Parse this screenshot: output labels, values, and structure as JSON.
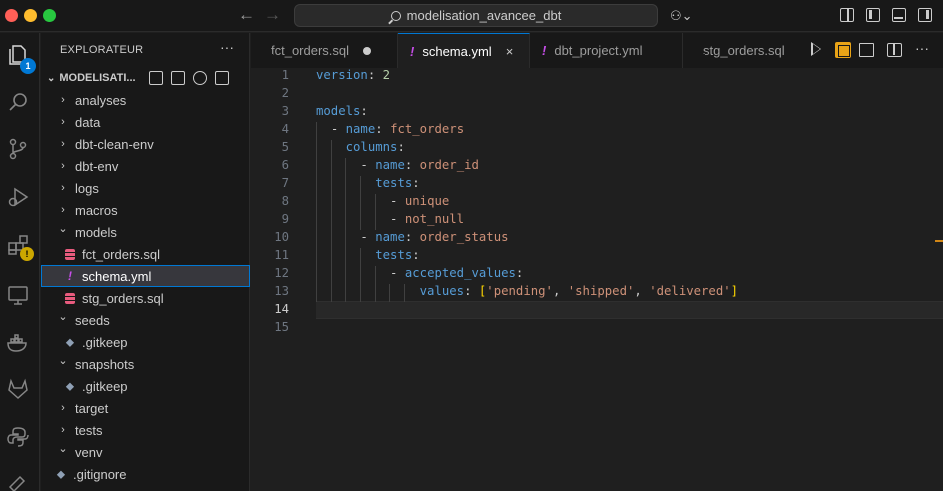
{
  "titlebar": {
    "search_text": "modelisation_avancee_dbt",
    "back_arrow": "←",
    "forward_arrow": "→",
    "copilot_glyph": "⚇⌄"
  },
  "activity": {
    "explorer_badge": "1",
    "extensions_warning": "!"
  },
  "sidebar": {
    "title": "EXPLORATEUR",
    "more": "···",
    "root_label": "MODELISATI...",
    "items": [
      {
        "label": "analyses",
        "kind": "folder",
        "open": false
      },
      {
        "label": "data",
        "kind": "folder",
        "open": false
      },
      {
        "label": "dbt-clean-env",
        "kind": "folder",
        "open": false
      },
      {
        "label": "dbt-env",
        "kind": "folder",
        "open": false
      },
      {
        "label": "logs",
        "kind": "folder",
        "open": false
      },
      {
        "label": "macros",
        "kind": "folder",
        "open": false
      },
      {
        "label": "models",
        "kind": "folder",
        "open": true
      },
      {
        "label": "fct_orders.sql",
        "kind": "sql"
      },
      {
        "label": "schema.yml",
        "kind": "yml",
        "selected": true
      },
      {
        "label": "stg_orders.sql",
        "kind": "sql"
      },
      {
        "label": "seeds",
        "kind": "folder",
        "open": true
      },
      {
        "label": ".gitkeep",
        "kind": "gitkeep"
      },
      {
        "label": "snapshots",
        "kind": "folder",
        "open": true
      },
      {
        "label": ".gitkeep",
        "kind": "gitkeep"
      },
      {
        "label": "target",
        "kind": "folder",
        "open": false
      },
      {
        "label": "tests",
        "kind": "folder",
        "open": false
      },
      {
        "label": "venv",
        "kind": "folder",
        "open": true
      },
      {
        "label": ".gitignore",
        "kind": "gitignore"
      }
    ]
  },
  "tabs": [
    {
      "label": "fct_orders.sql",
      "kind": "sql",
      "modified": true
    },
    {
      "label": "schema.yml",
      "kind": "yml",
      "active": true,
      "close": "×"
    },
    {
      "label": "dbt_project.yml",
      "kind": "yml"
    },
    {
      "label": "stg_orders.sql",
      "kind": "sql"
    }
  ],
  "editor": {
    "line_numbers": [
      "1",
      "2",
      "3",
      "4",
      "5",
      "6",
      "7",
      "8",
      "9",
      "10",
      "11",
      "12",
      "13",
      "14",
      "15"
    ],
    "lines": {
      "l1_key": "version",
      "l1_colon": ": ",
      "l1_val": "2",
      "l3_key": "models",
      "l3_colon": ":",
      "l4_dash": "- ",
      "l4_key": "name",
      "l4_colon": ": ",
      "l4_val": "fct_orders",
      "l5_key": "columns",
      "l5_colon": ":",
      "l6_dash": "- ",
      "l6_key": "name",
      "l6_colon": ": ",
      "l6_val": "order_id",
      "l7_key": "tests",
      "l7_colon": ":",
      "l8_dash": "- ",
      "l8_val": "unique",
      "l9_dash": "- ",
      "l9_val": "not_null",
      "l10_dash": "- ",
      "l10_key": "name",
      "l10_colon": ": ",
      "l10_val": "order_status",
      "l11_key": "tests",
      "l11_colon": ":",
      "l12_dash": "- ",
      "l12_key": "accepted_values",
      "l12_colon": ":",
      "l13_key": "values",
      "l13_colon": ": ",
      "l13_open": "[",
      "l13_v1": "'pending'",
      "l13_c1": ", ",
      "l13_v2": "'shipped'",
      "l13_c2": ", ",
      "l13_v3": "'delivered'",
      "l13_close": "]"
    }
  },
  "colors": {
    "accent": "#0078d4",
    "yaml_key": "#569cd6",
    "yaml_string": "#ce9178",
    "yaml_number": "#b5cea8",
    "sql_icon": "#e85b7e",
    "yml_icon": "#c64ee8"
  }
}
